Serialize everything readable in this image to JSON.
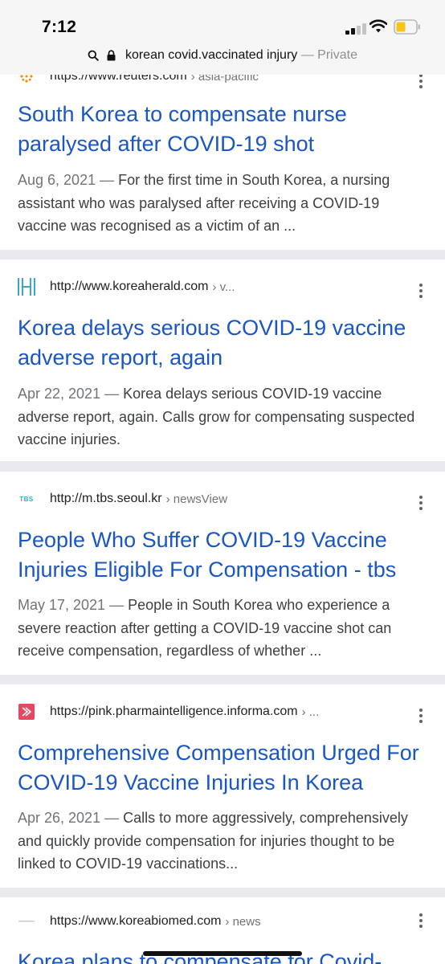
{
  "status_bar": {
    "time": "7:12"
  },
  "url_bar": {
    "query": "korean covid.vaccinated injury",
    "separator": " — ",
    "mode": "Private"
  },
  "results": [
    {
      "site_url": "https://www.reuters.com",
      "crumb": "› asia-pacific",
      "title": "South Korea to compensate nurse paralysed after COVID-19 shot",
      "date": "Aug 6, 2021",
      "dash": " — ",
      "snippet": "For the first time in South Korea, a nursing assistant who was paralysed after receiving a COVID-19 vaccine was recognised as a victim of an ..."
    },
    {
      "site_url": "http://www.koreaherald.com",
      "crumb": "› v...",
      "title": "Korea delays serious COVID-19 vaccine adverse report, again",
      "date": "Apr 22, 2021",
      "dash": " — ",
      "snippet": "Korea delays serious COVID-19 vaccine adverse report, again. Calls grow for compensating suspected vaccine injuries."
    },
    {
      "site_url": "http://m.tbs.seoul.kr",
      "crumb": "› newsView",
      "favicon_text": "TBS",
      "title": "People Who Suffer COVID-19 Vaccine Injuries Eligible For Compensation - tbs",
      "date": "May 17, 2021",
      "dash": " — ",
      "snippet": "People in South Korea who experience a severe reaction after getting a COVID-19 vaccine shot can receive compensation, regardless of whether ..."
    },
    {
      "site_url": "https://pink.pharmaintelligence.informa.com",
      "crumb": "› ...",
      "title": "Comprehensive Compensation Urged For COVID-19 Vaccine Injuries In Korea",
      "date": "Apr 26, 2021",
      "dash": " — ",
      "snippet": "Calls to more aggressively, comprehensively and quickly provide compensation for injuries thought to be linked to COVID-19 vaccinations..."
    },
    {
      "site_url": "https://www.koreabiomed.com",
      "crumb": "› news",
      "title": "Korea plans to compensate for Covid-"
    }
  ],
  "colors": {
    "link": "#1a56c4",
    "background": "#e9e9ee",
    "card": "#ffffff"
  }
}
